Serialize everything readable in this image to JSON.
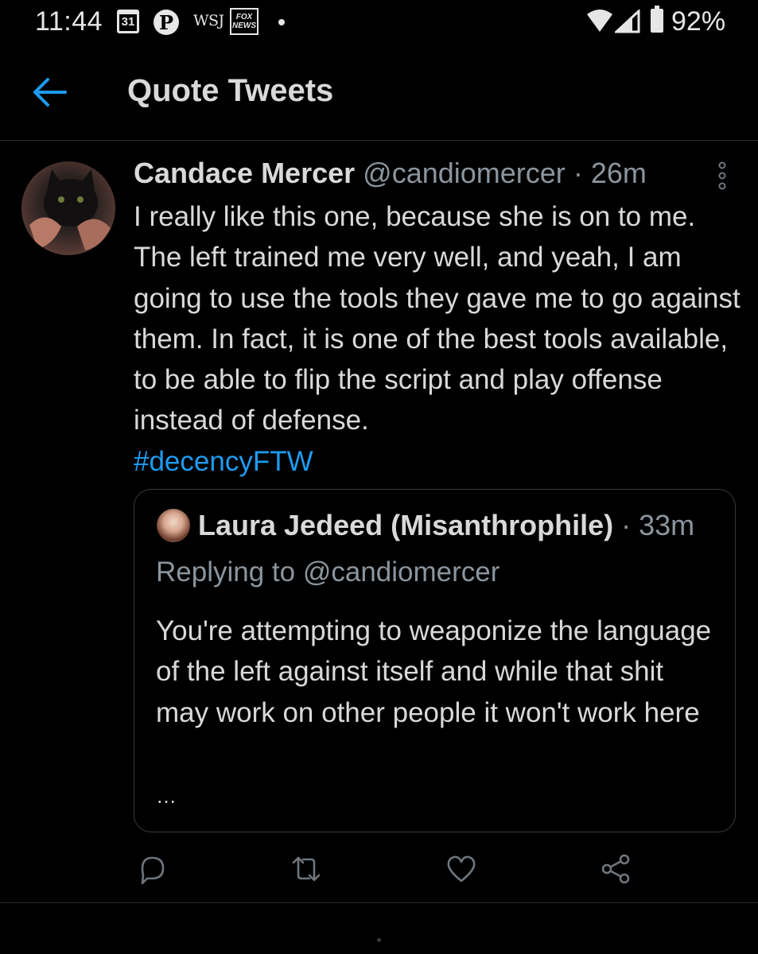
{
  "status_bar": {
    "time": "11:44",
    "calendar_day": "31",
    "pinterest_glyph": "P",
    "wsj_label": "WSJ",
    "fox_label_line1": "FOX",
    "fox_label_line2": "NEWS",
    "battery_percent": "92%",
    "icons": [
      "calendar-icon",
      "pinterest-icon",
      "wsj-icon",
      "fox-news-icon",
      "notification-dot-icon",
      "wifi-icon",
      "signal-icon",
      "battery-icon"
    ]
  },
  "header": {
    "title": "Quote Tweets",
    "back_icon": "arrow-left-icon"
  },
  "tweet": {
    "author_name": "Candace Mercer",
    "author_handle": "@candiomercer",
    "separator": "·",
    "time": "26m",
    "text": "I really like this one, because she is on to me. The left trained me very well, and yeah, I am going to use the tools they gave me to go against them. In fact, it is one of the best tools available, to be able to flip the script and play offense instead of defense.",
    "hashtag": "#decencyFTW",
    "quoted": {
      "author_name": "Laura Jedeed (Misanthrophile)",
      "separator": "·",
      "time": "33m",
      "replying_to": "Replying to @candiomercer",
      "text": "You're attempting to weaponize the language of the left against itself and while that shit may work on other people it won't work here",
      "ellipsis": "…"
    },
    "actions": [
      "reply-icon",
      "retweet-icon",
      "like-icon",
      "share-icon"
    ]
  },
  "colors": {
    "background": "#000000",
    "text_primary": "#d9d9d9",
    "text_secondary": "#8b959e",
    "accent": "#1d9bf0",
    "divider": "#2b2b2b"
  }
}
